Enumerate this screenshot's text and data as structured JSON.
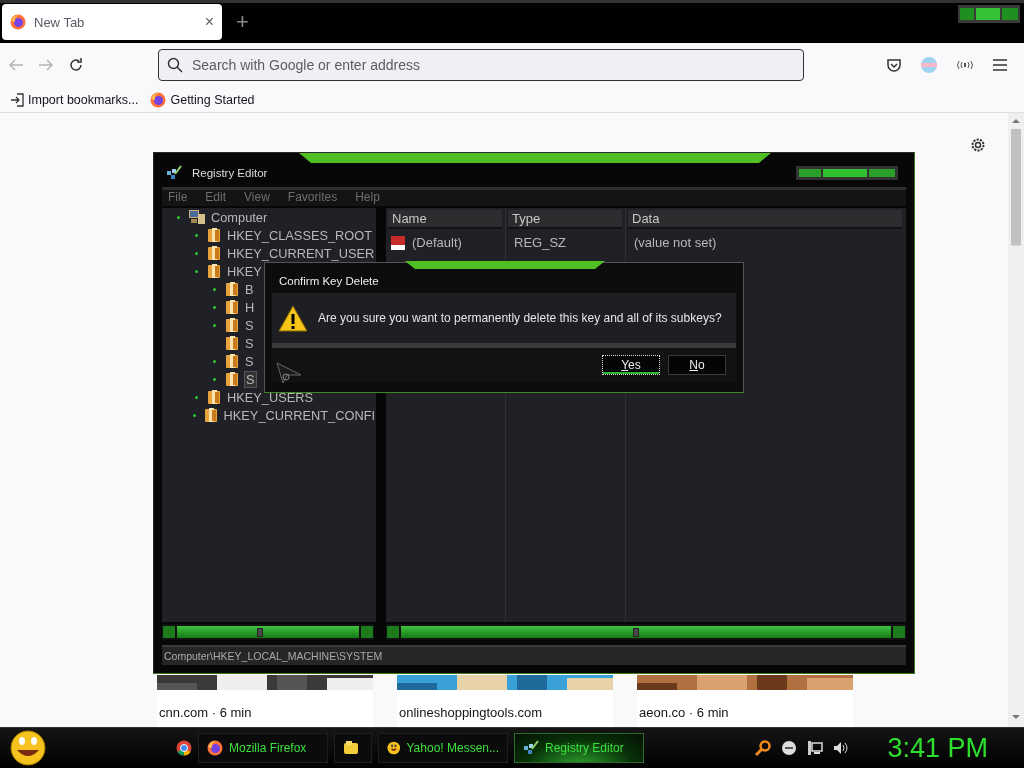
{
  "browser": {
    "tabs": [
      {
        "title": "New Tab",
        "close": "×",
        "selected": true
      }
    ],
    "new_tab": "+",
    "address_bar": {
      "placeholder": "Search with Google or enter address"
    },
    "bookmarks": [
      {
        "label": "Import bookmarks...",
        "kind": "import"
      },
      {
        "label": "Getting Started",
        "kind": "firefox"
      }
    ],
    "cards": [
      {
        "caption": "cnn.com · 6 min",
        "kind": "picture"
      },
      {
        "caption": "onlineshoppingtools.com",
        "kind": "picture"
      },
      {
        "caption": "aeon.co · 6 min",
        "kind": "picture"
      }
    ]
  },
  "registry_editor": {
    "title": "Registry Editor",
    "menu": [
      "File",
      "Edit",
      "View",
      "Favorites",
      "Help"
    ],
    "tree": [
      {
        "label": "Computer",
        "kind": "computer",
        "expander": true,
        "selected": false,
        "children": [
          {
            "label": "HKEY_CLASSES_ROOT",
            "kind": "folder",
            "expander": true,
            "selected": false
          },
          {
            "label": "HKEY_CURRENT_USER",
            "kind": "folder",
            "expander": true,
            "selected": false
          },
          {
            "label": "HKEY",
            "kind": "folder",
            "expander": true,
            "selected": false,
            "children": [
              {
                "label": "B",
                "kind": "folder",
                "expander": true,
                "selected": false
              },
              {
                "label": "H",
                "kind": "folder",
                "expander": true,
                "selected": false
              },
              {
                "label": "S",
                "kind": "folder",
                "expander": true,
                "selected": false
              },
              {
                "label": "S",
                "kind": "folder",
                "expander": false,
                "selected": false
              },
              {
                "label": "S",
                "kind": "folder",
                "expander": true,
                "selected": false
              },
              {
                "label": "S",
                "kind": "folder",
                "expander": true,
                "selected": true
              }
            ]
          },
          {
            "label": "HKEY_USERS",
            "kind": "folder",
            "expander": true,
            "selected": false
          },
          {
            "label": "HKEY_CURRENT_CONFI",
            "kind": "folder",
            "expander": true,
            "selected": false
          }
        ]
      }
    ],
    "table": {
      "columns": [
        "Name",
        "Type",
        "Data"
      ],
      "rows": [
        [
          "(Default)",
          "REG_SZ",
          "(value not set)"
        ]
      ]
    },
    "status_bar": "Computer\\HKEY_LOCAL_MACHINE\\SYSTEM"
  },
  "dialog": {
    "title": "Confirm Key Delete",
    "message": "Are you sure you want to permanently delete this key and all of its subkeys?",
    "buttons": [
      {
        "label": "Yes",
        "focused": true
      },
      {
        "label": "No",
        "focused": false
      }
    ]
  },
  "taskbar": {
    "tasks": [
      {
        "kind": "firefox",
        "label": "Mozilla Firefox",
        "selected": false
      },
      {
        "kind": "folder",
        "selected": false
      },
      {
        "kind": "messenger",
        "label": "Yahoo! Messen...",
        "selected": false
      },
      {
        "kind": "registry",
        "label": "Registry Editor",
        "selected": true
      }
    ],
    "clock": "3:41 PM"
  }
}
